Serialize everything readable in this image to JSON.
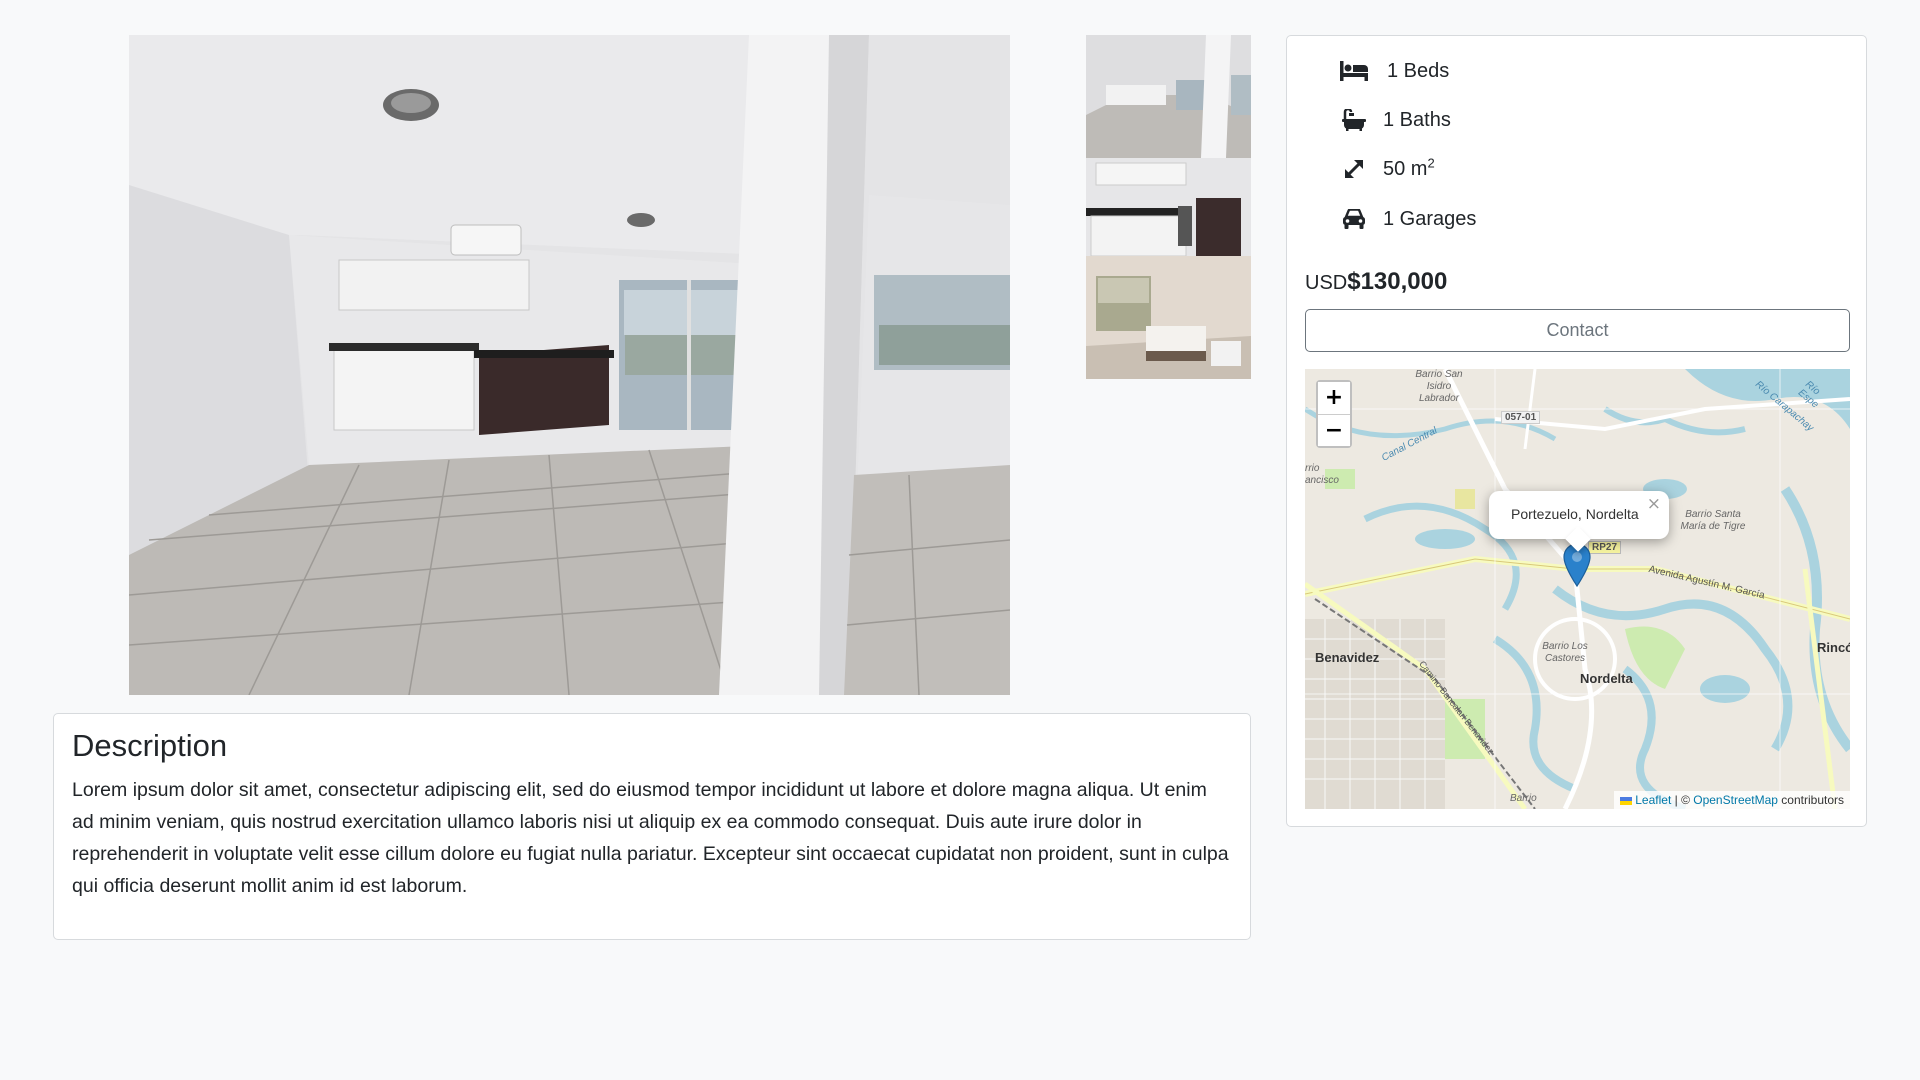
{
  "gallery": {
    "main_image": "apartment-living-room-photo",
    "thumbnails": [
      "apartment-overview-photo",
      "kitchen-photo",
      "bedroom-photo"
    ]
  },
  "description": {
    "title": "Description",
    "text": "Lorem ipsum dolor sit amet, consectetur adipiscing elit, sed do eiusmod tempor incididunt ut labore et dolore magna aliqua. Ut enim ad minim veniam, quis nostrud exercitation ullamco laboris nisi ut aliquip ex ea commodo consequat. Duis aute irure dolor in reprehenderit in voluptate velit esse cillum dolore eu fugiat nulla pariatur. Excepteur sint occaecat cupidatat non proident, sunt in culpa qui officia deserunt mollit anim id est laborum."
  },
  "features": {
    "beds": {
      "label": "1 Beds",
      "icon": "bed-icon"
    },
    "baths": {
      "label": "1 Baths",
      "icon": "bath-icon"
    },
    "area": {
      "label": "50 m",
      "unit_sup": "2",
      "icon": "expand-arrows-icon"
    },
    "garages": {
      "label": "1 Garages",
      "icon": "car-icon"
    }
  },
  "price": {
    "currency": "USD",
    "amount": "$130,000"
  },
  "contact": {
    "label": "Contact"
  },
  "map": {
    "zoom_in": "+",
    "zoom_out": "−",
    "popup_text": "Portezuelo, Nordelta",
    "popup_close": "×",
    "labels": {
      "benavidez": "Benavidez",
      "nordelta": "Nordelta",
      "rinco": "Rincó",
      "barrio_san_isidro": "Barrio San Isidro Labrador",
      "barrio_santa_maria": "Barrio Santa María de Tigre",
      "barrio_castores": "Barrio Los Castores",
      "road_057": "057-01",
      "road_rp27": "RP27",
      "avenida": "Avenida Agustín M. García",
      "canal": "Canal Central",
      "francisco": "rrio ancisco",
      "barrio_bottom": "Barrio",
      "camino": "Camino Bancalari Benavidez",
      "rio": "Río Carapachay",
      "rio_espera": "Río Espe"
    },
    "attribution": {
      "leaflet": "Leaflet",
      "sep": " | © ",
      "osm": "OpenStreetMap",
      "contributors": " contributors"
    },
    "colors": {
      "marker": "#2a81cb",
      "link": "#0078a8",
      "water": "#aad3df",
      "green": "#cdebb0"
    }
  }
}
